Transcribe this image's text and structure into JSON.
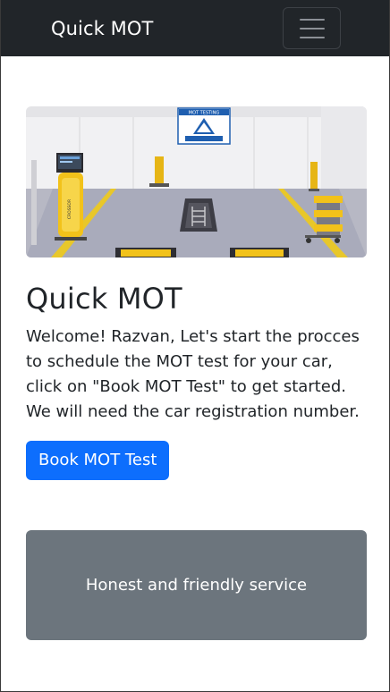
{
  "navbar": {
    "brand": "Quick MOT",
    "toggler_icon": "hamburger-menu-icon"
  },
  "hero": {
    "sign_title": "MOT TESTING",
    "console_brand": "CROSSOR"
  },
  "main": {
    "title": "Quick MOT",
    "intro": "Welcome! Razvan, Let's start the procces to schedule the MOT test for your car, click on \"Book MOT Test\" to get started. We will need the car registration number.",
    "book_button": "Book MOT Test"
  },
  "feature": {
    "text": "Honest and friendly service"
  },
  "colors": {
    "navbar_bg": "#212529",
    "primary": "#0d6efd",
    "card_bg": "#6c757d"
  }
}
